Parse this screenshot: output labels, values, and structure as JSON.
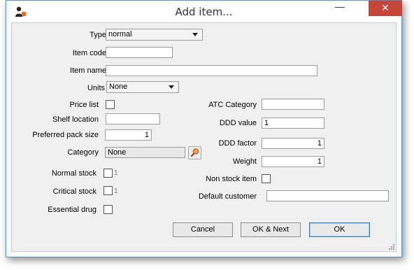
{
  "window": {
    "title": "Add item...",
    "minimize_glyph": "—",
    "close_glyph": "✕",
    "app_icon": "user-pill-icon",
    "close_color": "#c7463a"
  },
  "form": {
    "type": {
      "label": "Type",
      "value": "normal"
    },
    "item_code": {
      "label": "Item code",
      "value": ""
    },
    "item_name": {
      "label": "Item name",
      "value": ""
    },
    "units": {
      "label": "Units",
      "value": "None"
    },
    "price_list": {
      "label": "Price list",
      "checked": false
    },
    "shelf_location": {
      "label": "Shelf location",
      "value": ""
    },
    "preferred_pack_size": {
      "label": "Preferred pack size",
      "value": "1"
    },
    "category": {
      "label": "Category",
      "value": "None",
      "lookup_icon": "search-icon"
    },
    "normal_stock": {
      "label": "Normal stock",
      "checked": false,
      "tick": "1"
    },
    "critical_stock": {
      "label": "Critical stock",
      "checked": false,
      "tick": "1"
    },
    "essential_drug": {
      "label": "Essential drug",
      "checked": false
    },
    "atc_category": {
      "label": "ATC Category",
      "value": ""
    },
    "ddd_value": {
      "label": "DDD value",
      "value": "1"
    },
    "ddd_factor": {
      "label": "DDD factor",
      "value": "1"
    },
    "weight": {
      "label": "Weight",
      "value": "1"
    },
    "non_stock_item": {
      "label": "Non stock item",
      "checked": false
    },
    "default_customer": {
      "label": "Default customer",
      "value": ""
    }
  },
  "buttons": {
    "cancel": "Cancel",
    "ok_next": "OK & Next",
    "ok": "OK"
  },
  "colors": {
    "accent": "#3c7fb1",
    "window_border": "#5a8fc8"
  }
}
